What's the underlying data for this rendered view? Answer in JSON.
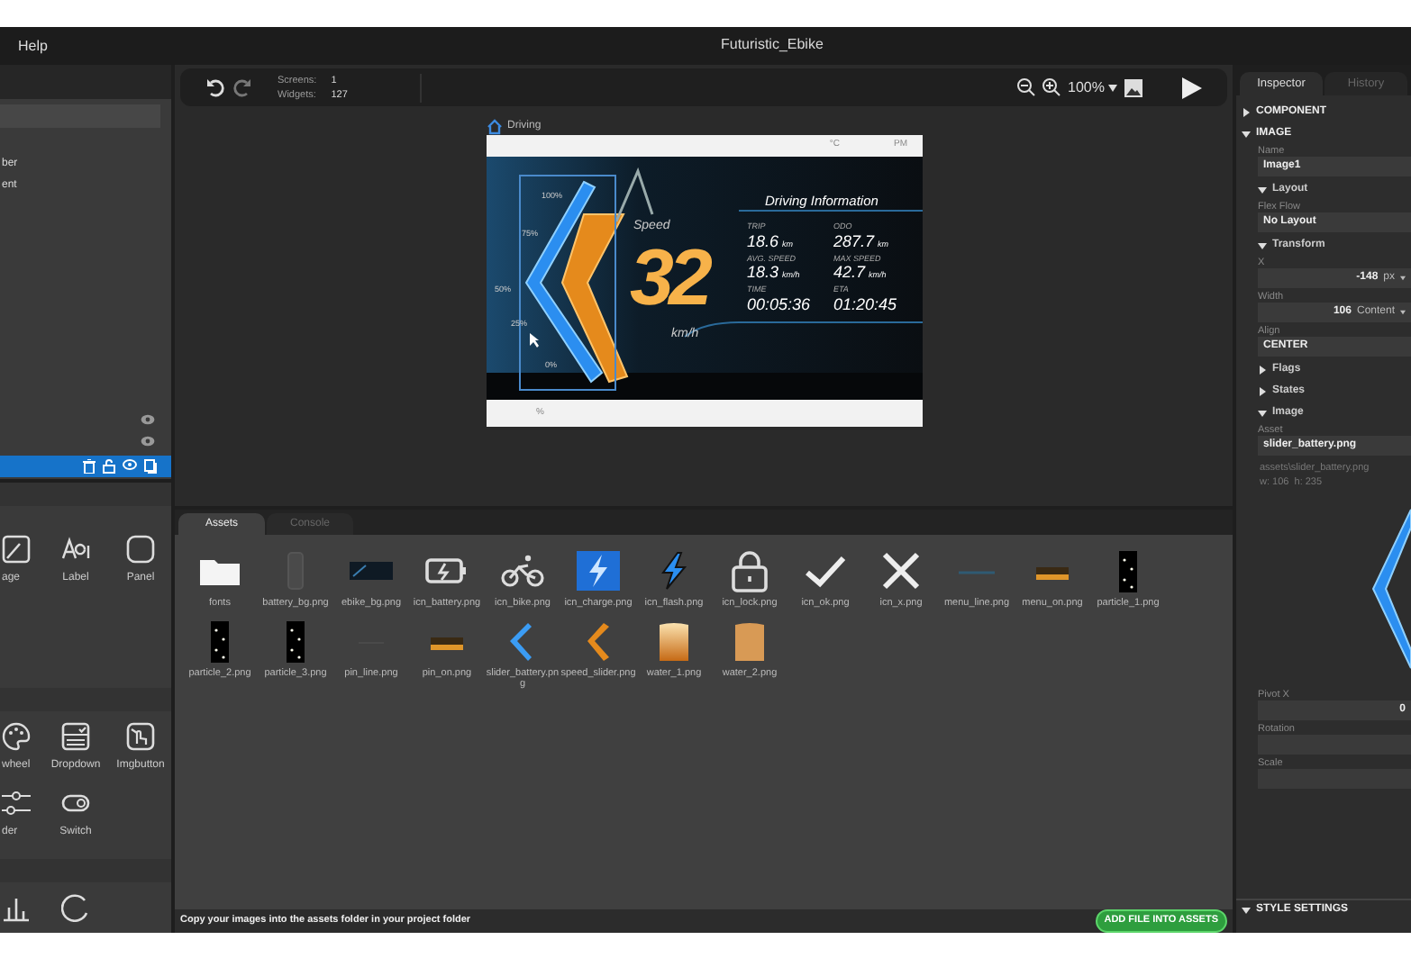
{
  "menu": {
    "items": [
      "Help"
    ]
  },
  "window": {
    "title": "Futuristic_Ebike"
  },
  "layers": [
    {
      "label": "ber",
      "selected": false,
      "eye": false
    },
    {
      "label": "ent",
      "selected": false,
      "eye": false
    },
    {
      "selected": false,
      "eye": true
    },
    {
      "selected": false,
      "eye": true
    },
    {
      "selected": true,
      "eye": false
    }
  ],
  "palette": [
    {
      "items": [
        {
          "label": "age",
          "kind": "image"
        },
        {
          "label": "Label",
          "kind": "text"
        },
        {
          "label": "Panel",
          "kind": "panel"
        }
      ]
    },
    {
      "items": [
        {
          "label": "wheel",
          "kind": "palette"
        },
        {
          "label": "Dropdown",
          "kind": "dropdown"
        },
        {
          "label": "Imgbutton",
          "kind": "imgbutton"
        },
        {
          "label": "der",
          "kind": "slider"
        },
        {
          "label": "Switch",
          "kind": "switch"
        }
      ]
    },
    {
      "items": [
        {
          "kind": "chart"
        },
        {
          "kind": "spinner"
        }
      ]
    }
  ],
  "toolbar": {
    "stats": [
      {
        "label": "Screens:",
        "value": "1"
      },
      {
        "label": "Widgets:",
        "value": "127"
      }
    ],
    "zoom": "100%"
  },
  "screen": {
    "name": "Driving",
    "top_bar": [
      "°C",
      "PM"
    ],
    "bottom_bar": [
      "%"
    ],
    "heading": "Driving Information",
    "speed_label": "Speed",
    "speed": "32",
    "speed_unit": "km/h",
    "battery_ticks": [
      "100%",
      "75%",
      "50%",
      "25%",
      "0%"
    ],
    "stats": [
      {
        "label": "TRIP",
        "value": "18.6",
        "unit": "km"
      },
      {
        "label": "ODO",
        "value": "287.7",
        "unit": "km"
      },
      {
        "label": "AVG. SPEED",
        "value": "18.3",
        "unit": "km/h"
      },
      {
        "label": "MAX SPEED",
        "value": "42.7",
        "unit": "km/h"
      },
      {
        "label": "TIME",
        "value": "00:05:36"
      },
      {
        "label": "ETA",
        "value": "01:20:45"
      }
    ]
  },
  "bottom_tabs": [
    {
      "label": "Assets",
      "selected": true
    },
    {
      "label": "Console",
      "selected": false
    }
  ],
  "assets": [
    {
      "name": "fonts",
      "kind": "folder"
    },
    {
      "name": "battery_bg.png",
      "kind": "battery_bg"
    },
    {
      "name": "ebike_bg.png",
      "kind": "dark"
    },
    {
      "name": "icn_battery.png",
      "kind": "battery"
    },
    {
      "name": "icn_bike.png",
      "kind": "bike"
    },
    {
      "name": "icn_charge.png",
      "kind": "charge"
    },
    {
      "name": "icn_flash.png",
      "kind": "flash"
    },
    {
      "name": "icn_lock.png",
      "kind": "lock"
    },
    {
      "name": "icn_ok.png",
      "kind": "check"
    },
    {
      "name": "icn_x.png",
      "kind": "cross"
    },
    {
      "name": "menu_line.png",
      "kind": "line"
    },
    {
      "name": "menu_on.png",
      "kind": "glow"
    },
    {
      "name": "particle_1.png",
      "kind": "particle"
    },
    {
      "name": "particle_2.png",
      "kind": "particle"
    },
    {
      "name": "particle_3.png",
      "kind": "particle"
    },
    {
      "name": "pin_line.png",
      "kind": "blank"
    },
    {
      "name": "pin_on.png",
      "kind": "glow"
    },
    {
      "name": "slider_battery.png",
      "kind": "chevron_blue"
    },
    {
      "name": "speed_slider.png",
      "kind": "chevron_orange"
    },
    {
      "name": "water_1.png",
      "kind": "gradient"
    },
    {
      "name": "water_2.png",
      "kind": "tan"
    }
  ],
  "assets_footer": "Copy your images into the assets folder in your project folder",
  "add_button": "ADD FILE INTO ASSETS",
  "inspector": {
    "tabs": [
      {
        "label": "Inspector",
        "selected": true
      },
      {
        "label": "History",
        "selected": false
      }
    ],
    "rows": [
      {
        "kind": "section",
        "title": "COMPONENT",
        "expanded": false
      },
      {
        "kind": "section",
        "title": "IMAGE",
        "expanded": true
      },
      {
        "kind": "field",
        "label": "Name",
        "value": "Image1"
      },
      {
        "kind": "group",
        "title": "Layout",
        "expanded": true
      },
      {
        "kind": "field",
        "label": "Flex Flow",
        "value": "No Layout"
      },
      {
        "kind": "group",
        "title": "Transform",
        "expanded": true
      },
      {
        "kind": "number",
        "label": "X",
        "value": "-148",
        "unit": "px"
      },
      {
        "kind": "number",
        "label": "Width",
        "value": "106",
        "unit": "Content"
      },
      {
        "kind": "field",
        "label": "Align",
        "value": "CENTER"
      },
      {
        "kind": "group",
        "title": "Flags",
        "expanded": false
      },
      {
        "kind": "group",
        "title": "States",
        "expanded": false
      },
      {
        "kind": "group",
        "title": "Image",
        "expanded": true
      },
      {
        "kind": "field",
        "label": "Asset",
        "value": "slider_battery.png"
      },
      {
        "kind": "info",
        "lines": [
          "assets\\slider_battery.png",
          "w: 106  h: 235"
        ]
      },
      {
        "kind": "preview"
      },
      {
        "kind": "number",
        "label": "Pivot X",
        "value": "0"
      },
      {
        "kind": "field",
        "label": "Rotation"
      },
      {
        "kind": "field",
        "label": "Scale"
      },
      {
        "kind": "section",
        "title": "STYLE SETTINGS",
        "expanded": true
      }
    ]
  }
}
